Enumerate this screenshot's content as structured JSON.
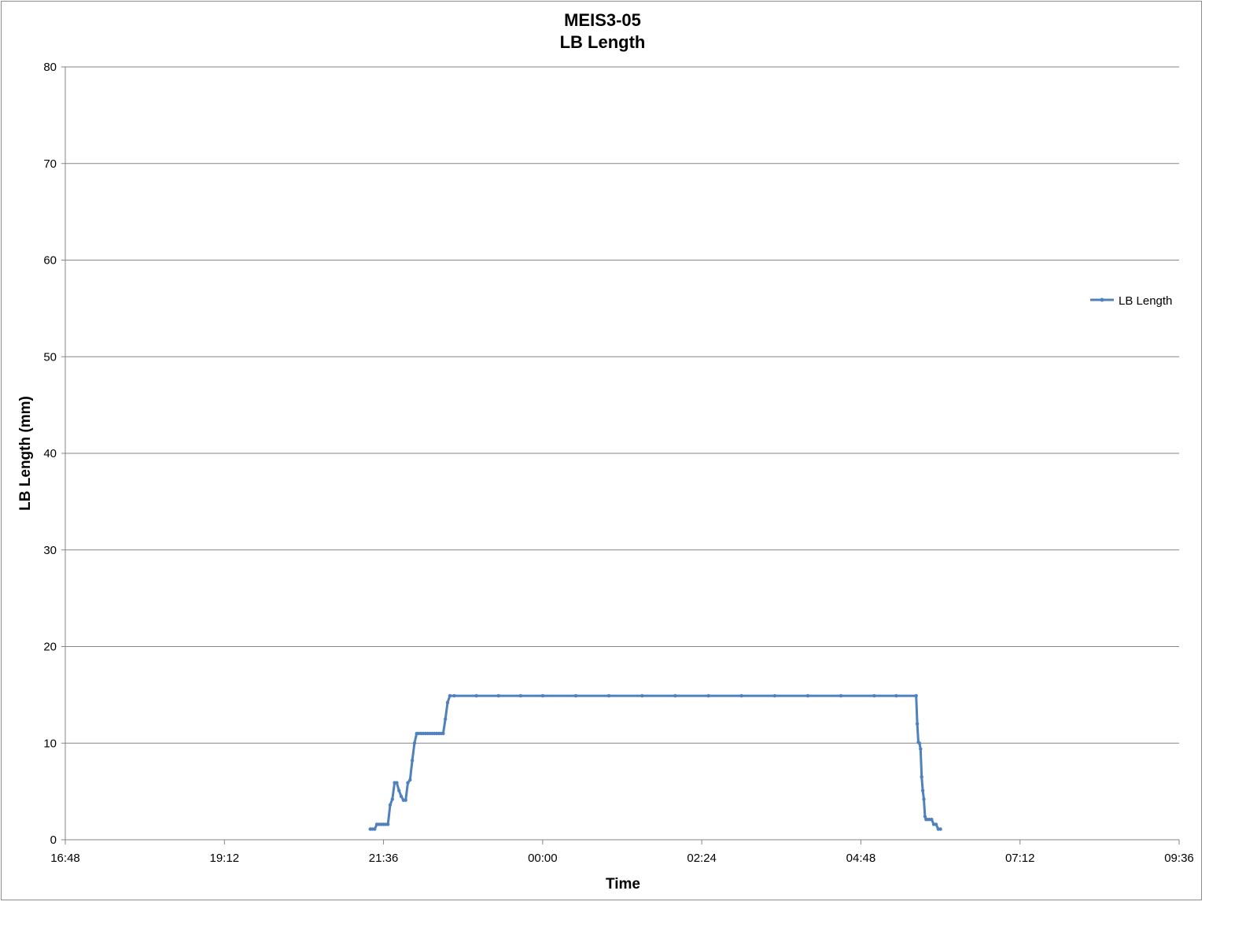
{
  "chart_data": {
    "type": "line",
    "title": [
      "MEIS3-05",
      "LB Length"
    ],
    "xlabel": "Time",
    "ylabel": "LB Length (mm)",
    "xlim": [
      "16:48",
      "09:36"
    ],
    "ylim": [
      0,
      80
    ],
    "x_ticks": [
      "16:48",
      "19:12",
      "21:36",
      "00:00",
      "02:24",
      "04:48",
      "07:12",
      "09:36"
    ],
    "y_ticks": [
      "0",
      "10",
      "20",
      "30",
      "40",
      "50",
      "60",
      "70",
      "80"
    ],
    "grid": "horizontal",
    "legend": "right",
    "colors": {
      "series": "#4f81bd",
      "grid": "#868686",
      "axis": "#868686"
    },
    "series": [
      {
        "name": "LB Length",
        "points": [
          [
            "21:24",
            1.1
          ],
          [
            "21:26",
            1.1
          ],
          [
            "21:28",
            1.1
          ],
          [
            "21:30",
            1.6
          ],
          [
            "21:32",
            1.6
          ],
          [
            "21:34",
            1.6
          ],
          [
            "21:36",
            1.6
          ],
          [
            "21:38",
            1.6
          ],
          [
            "21:40",
            1.6
          ],
          [
            "21:42",
            3.6
          ],
          [
            "21:44",
            4.2
          ],
          [
            "21:46",
            5.9
          ],
          [
            "21:48",
            5.9
          ],
          [
            "21:50",
            5.1
          ],
          [
            "21:52",
            4.5
          ],
          [
            "21:54",
            4.1
          ],
          [
            "21:56",
            4.1
          ],
          [
            "21:58",
            5.9
          ],
          [
            "22:00",
            6.2
          ],
          [
            "22:02",
            8.2
          ],
          [
            "22:04",
            10.0
          ],
          [
            "22:06",
            11.0
          ],
          [
            "22:08",
            11.0
          ],
          [
            "22:10",
            11.0
          ],
          [
            "22:12",
            11.0
          ],
          [
            "22:14",
            11.0
          ],
          [
            "22:16",
            11.0
          ],
          [
            "22:18",
            11.0
          ],
          [
            "22:20",
            11.0
          ],
          [
            "22:22",
            11.0
          ],
          [
            "22:24",
            11.0
          ],
          [
            "22:26",
            11.0
          ],
          [
            "22:28",
            11.0
          ],
          [
            "22:30",
            11.0
          ],
          [
            "22:32",
            12.5
          ],
          [
            "22:34",
            14.2
          ],
          [
            "22:36",
            14.9
          ],
          [
            "22:40",
            14.9
          ],
          [
            "23:00",
            14.9
          ],
          [
            "23:20",
            14.9
          ],
          [
            "23:40",
            14.9
          ],
          [
            "00:00",
            14.9
          ],
          [
            "00:30",
            14.9
          ],
          [
            "01:00",
            14.9
          ],
          [
            "01:30",
            14.9
          ],
          [
            "02:00",
            14.9
          ],
          [
            "02:30",
            14.9
          ],
          [
            "03:00",
            14.9
          ],
          [
            "03:30",
            14.9
          ],
          [
            "04:00",
            14.9
          ],
          [
            "04:30",
            14.9
          ],
          [
            "05:00",
            14.9
          ],
          [
            "05:20",
            14.9
          ],
          [
            "05:38",
            14.9
          ],
          [
            "05:39",
            12.0
          ],
          [
            "05:40",
            10.1
          ],
          [
            "05:41",
            10.0
          ],
          [
            "05:42",
            9.4
          ],
          [
            "05:43",
            6.5
          ],
          [
            "05:44",
            5.1
          ],
          [
            "05:45",
            4.2
          ],
          [
            "05:46",
            2.4
          ],
          [
            "05:47",
            2.1
          ],
          [
            "05:48",
            2.1
          ],
          [
            "05:50",
            2.1
          ],
          [
            "05:52",
            2.1
          ],
          [
            "05:54",
            1.6
          ],
          [
            "05:56",
            1.6
          ],
          [
            "05:58",
            1.1
          ],
          [
            "06:00",
            1.1
          ]
        ]
      }
    ]
  }
}
